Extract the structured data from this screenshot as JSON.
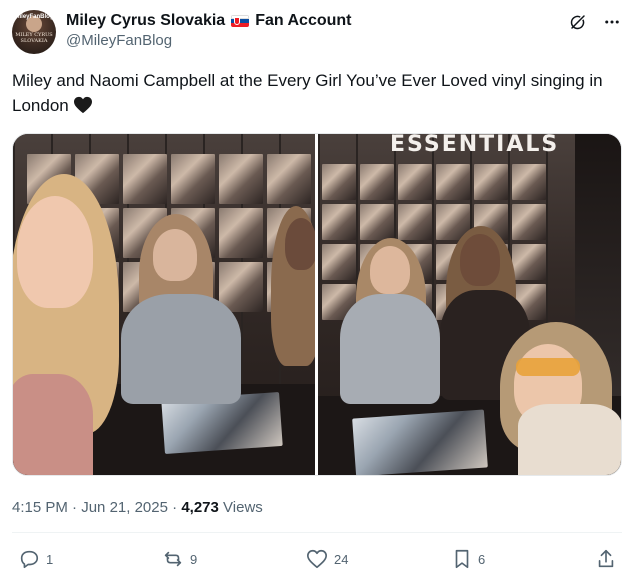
{
  "account": {
    "display_name": "Miley Cyrus Slovakia",
    "suffix": "Fan Account",
    "handle": "@MileyFanBlog",
    "avatar_text_top": "MileyFanBlog",
    "avatar_text_bottom": "MILEY CYRUS SLOVAKIA"
  },
  "tweet": {
    "text": "Miley and Naomi Campbell at the Every Girl You’ve Ever Loved vinyl singing in London",
    "emoji": "black-heart"
  },
  "media": {
    "right_banner": "ESSENTIALS"
  },
  "meta": {
    "time": "4:15 PM",
    "separator": "·",
    "date": "Jun 21, 2025",
    "views_count": "4,273",
    "views_label": "Views"
  },
  "actions": {
    "replies": "1",
    "reposts": "9",
    "likes": "24",
    "bookmarks": "6"
  },
  "icons": [
    "grok-icon",
    "more-icon",
    "reply-icon",
    "repost-icon",
    "like-icon",
    "bookmark-icon",
    "share-icon"
  ],
  "colors": {
    "text": "#0f1419",
    "secondary": "#536471",
    "divider": "#eff3f4"
  }
}
